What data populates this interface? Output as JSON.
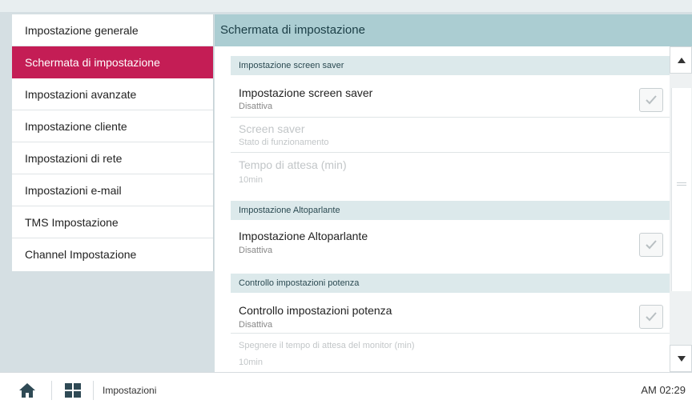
{
  "sidebar": {
    "items": [
      {
        "label": "Impostazione generale"
      },
      {
        "label": "Schermata di impostazione"
      },
      {
        "label": "Impostazioni avanzate"
      },
      {
        "label": "Impostazione cliente"
      },
      {
        "label": "Impostazioni di rete"
      },
      {
        "label": "Impostazioni e-mail"
      },
      {
        "label": "TMS Impostazione"
      },
      {
        "label": "Channel Impostazione"
      }
    ],
    "active_label": "Schermata di impostazione"
  },
  "main": {
    "title": "Schermata di impostazione",
    "sections": [
      {
        "header": "Impostazione screen saver",
        "rows": [
          {
            "title": "Impostazione screen saver",
            "subtitle": "Disattiva",
            "checkbox": true,
            "checked": false
          },
          {
            "title": "Screen saver",
            "subtitle": "Stato di funzionamento",
            "disabled": true
          },
          {
            "title": "Tempo di attesa (min)",
            "subtitle": "10min",
            "disabled": true
          }
        ]
      },
      {
        "header": "Impostazione Altoparlante",
        "rows": [
          {
            "title": "Impostazione Altoparlante",
            "subtitle": "Disattiva",
            "checkbox": true,
            "checked": false
          }
        ]
      },
      {
        "header": "Controllo impostazioni potenza",
        "rows": [
          {
            "title": "Controllo impostazioni potenza",
            "subtitle": "Disattiva",
            "checkbox": true,
            "checked": false
          },
          {
            "title": "Spegnere il tempo di attesa del monitor (min)",
            "subtitle": "10min",
            "disabled": true
          }
        ]
      }
    ]
  },
  "bottom_bar": {
    "breadcrumb": "Impostazioni",
    "clock": "AM 02:29",
    "icons": [
      "home-icon",
      "grid-menu-icon"
    ]
  },
  "colors": {
    "accent": "#c41d55",
    "header_bg": "#abcdd2",
    "section_bg": "#dce9eb",
    "background": "#d5dfe3"
  }
}
